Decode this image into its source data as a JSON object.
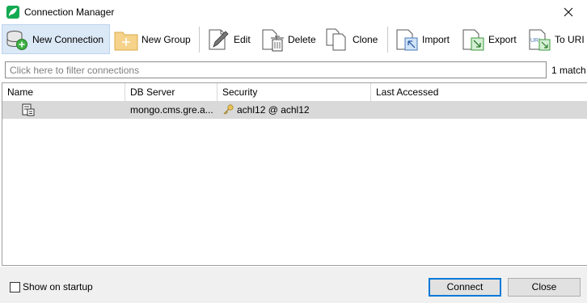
{
  "window": {
    "title": "Connection Manager",
    "app_icon": "leaf-icon",
    "close_icon": "close-icon"
  },
  "toolbar": {
    "items": [
      {
        "label": "New Connection",
        "icon": "database-add-icon"
      },
      {
        "label": "New Group",
        "icon": "folder-add-icon"
      },
      {
        "label": "Edit",
        "icon": "edit-icon"
      },
      {
        "label": "Delete",
        "icon": "delete-icon"
      },
      {
        "label": "Clone",
        "icon": "clone-icon"
      },
      {
        "label": "Import",
        "icon": "import-icon"
      },
      {
        "label": "Export",
        "icon": "export-icon"
      },
      {
        "label": "To URI",
        "icon": "uri-icon"
      }
    ]
  },
  "filter": {
    "placeholder": "Click here to filter connections",
    "value": "",
    "match_count": "1 match"
  },
  "table": {
    "columns": [
      "Name",
      "DB Server",
      "Security",
      "Last Accessed"
    ],
    "rows": [
      {
        "name": "",
        "db_server": "mongo.cms.gre.a...",
        "security": "achl12 @ achl12",
        "last_accessed": ""
      }
    ]
  },
  "footer": {
    "show_on_startup_label": "Show on startup",
    "show_on_startup_checked": false,
    "connect_label": "Connect",
    "close_label": "Close"
  }
}
